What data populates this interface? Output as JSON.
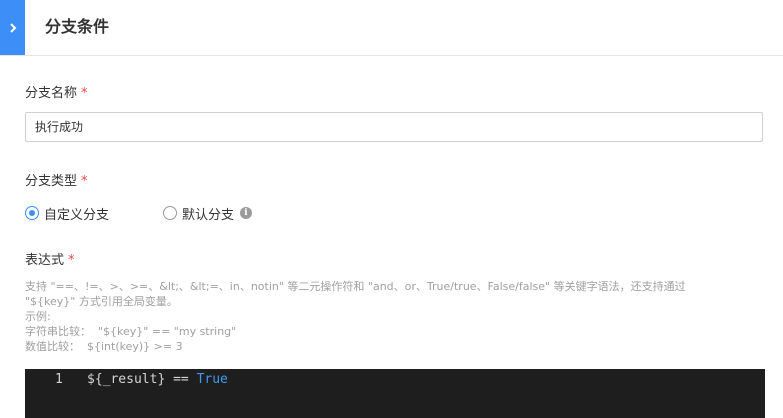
{
  "header": {
    "title": "分支条件"
  },
  "branch_name": {
    "label": "分支名称",
    "required_mark": "*",
    "value": "执行成功"
  },
  "branch_type": {
    "label": "分支类型",
    "required_mark": "*",
    "options": [
      {
        "label": "自定义分支",
        "selected": true
      },
      {
        "label": "默认分支",
        "selected": false
      }
    ]
  },
  "expression": {
    "label": "表达式",
    "required_mark": "*",
    "help_lines": [
      "支持 \"==、!=、>、>=、&lt;、&lt;=、in、notin\" 等二元操作符和 \"and、or、True/true、False/false\" 等关键字语法，还支持通过",
      "\"${key}\" 方式引用全局变量。",
      "示例:",
      "字符串比较：  \"${key}\" == \"my string\"",
      "数值比较：  ${int(key)} >= 3"
    ],
    "editor": {
      "line_number": "1",
      "code_text": "${_result} == ",
      "code_keyword": "True"
    }
  },
  "colors": {
    "accent": "#3d8ef7",
    "required": "#e8463f",
    "editor_bg": "#1e1e1e",
    "keyword": "#3d9bf0"
  }
}
